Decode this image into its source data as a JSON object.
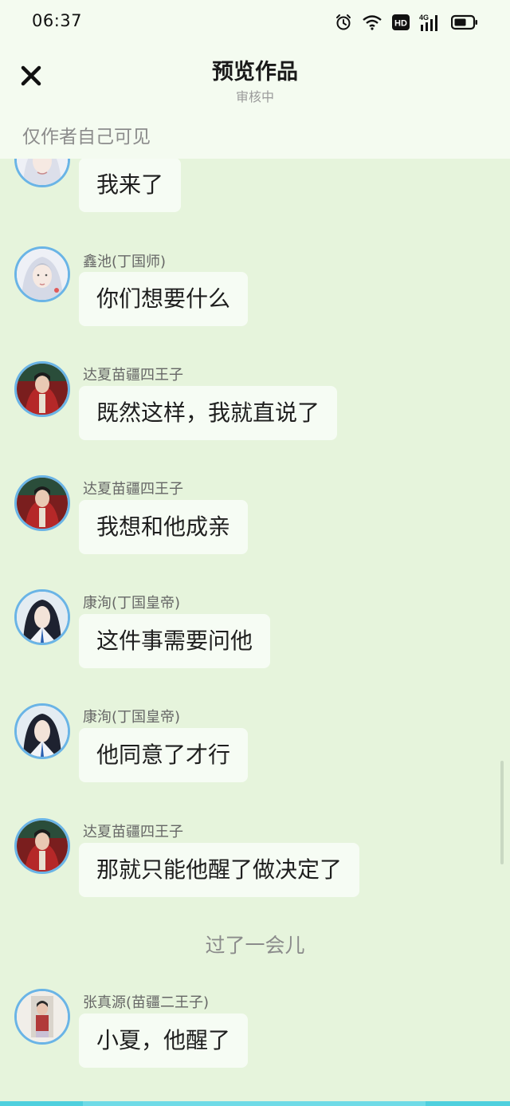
{
  "status_bar": {
    "time": "06:37",
    "icons": [
      "alarm-icon",
      "wifi-icon",
      "hd-icon",
      "signal-4g-icon",
      "battery-icon"
    ],
    "hd_label": "HD",
    "network_label": "4G"
  },
  "header": {
    "close_icon": "close-icon",
    "title": "预览作品",
    "subtitle": "审核中",
    "visibility_note": "仅作者自己可见"
  },
  "messages": [
    {
      "sender": "",
      "text": "我来了",
      "avatar": "avatar-white-hair"
    },
    {
      "sender": "鑫池(丁国师)",
      "text": "你们想要什么",
      "avatar": "avatar-white-hair"
    },
    {
      "sender": "达夏苗疆四王子",
      "text": "既然这样，我就直说了",
      "avatar": "avatar-red-prince"
    },
    {
      "sender": "达夏苗疆四王子",
      "text": "我想和他成亲",
      "avatar": "avatar-red-prince"
    },
    {
      "sender": "康洵(丁国皇帝)",
      "text": "这件事需要问他",
      "avatar": "avatar-dark-hair"
    },
    {
      "sender": "康洵(丁国皇帝)",
      "text": "他同意了才行",
      "avatar": "avatar-dark-hair"
    },
    {
      "sender": "达夏苗疆四王子",
      "text": "那就只能他醒了做决定了",
      "avatar": "avatar-red-prince"
    },
    {
      "sender": "张真源(苗疆二王子)",
      "text": "小夏，他醒了",
      "avatar": "avatar-photo"
    }
  ],
  "narration": "过了一会儿",
  "colors": {
    "background": "#e6f4dc",
    "header_background": "#f4fbf0",
    "bubble": "#f6fcf4",
    "avatar_border": "#6ab4e6",
    "bottom_bar": "#4fd0de"
  }
}
